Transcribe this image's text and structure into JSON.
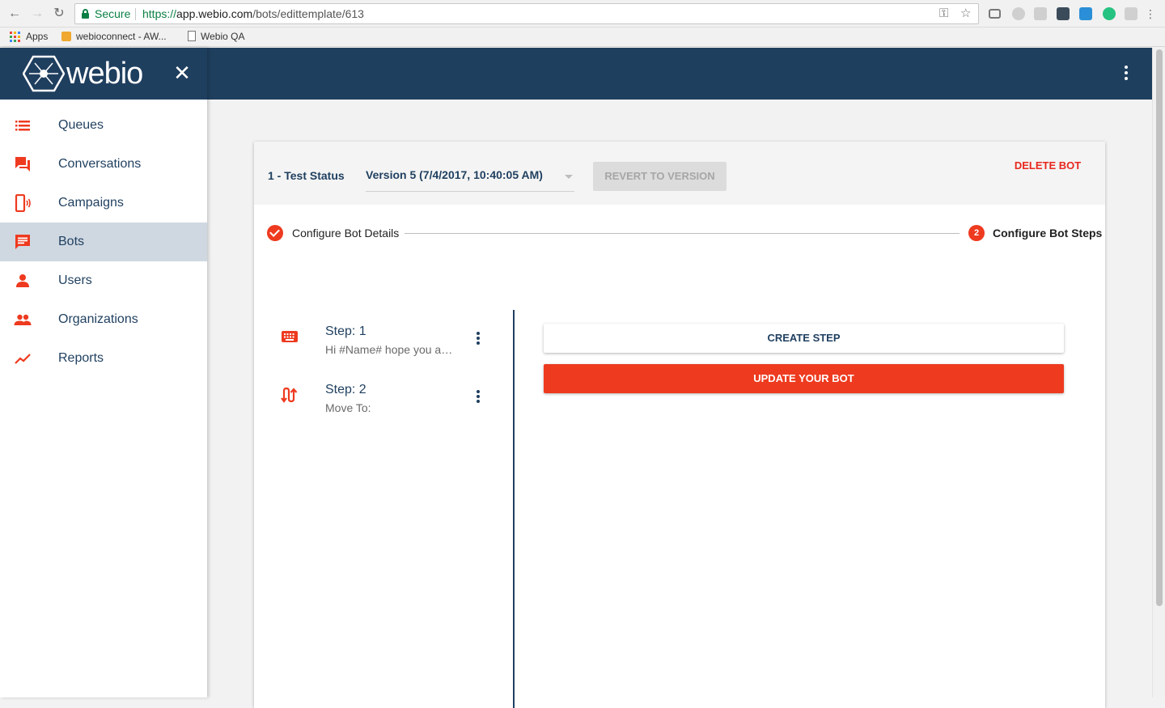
{
  "browser": {
    "secure_label": "Secure",
    "url_scheme": "https://",
    "url_host": "app.webio.com",
    "url_path": "/bots/edittemplate/613",
    "bookmarks": [
      {
        "label": "Apps",
        "icon": "apps-grid-icon"
      },
      {
        "label": "webioconnect - AW...",
        "icon": "box-icon"
      },
      {
        "label": "Webio QA",
        "icon": "page-icon"
      }
    ]
  },
  "brand": {
    "name": "webio",
    "header_color": "#1f3f5f",
    "accent_color": "#ee3a1f",
    "active_nav_color": "#cfd8e1"
  },
  "sidebar": {
    "items": [
      {
        "label": "Queues",
        "icon": "list-icon"
      },
      {
        "label": "Conversations",
        "icon": "chat-icon"
      },
      {
        "label": "Campaigns",
        "icon": "phone-ring-icon"
      },
      {
        "label": "Bots",
        "icon": "message-icon",
        "active": true
      },
      {
        "label": "Users",
        "icon": "person-icon"
      },
      {
        "label": "Organizations",
        "icon": "people-icon"
      },
      {
        "label": "Reports",
        "icon": "trend-icon"
      }
    ]
  },
  "bot": {
    "status_label": "1 - Test Status",
    "version_selected": "Version 5 (7/4/2017, 10:40:05 AM)",
    "revert_label": "REVERT TO VERSION",
    "delete_label": "DELETE BOT"
  },
  "stepper": {
    "step1_label": "Configure Bot Details",
    "step2_number": "2",
    "step2_label": "Configure Bot Steps"
  },
  "steps": [
    {
      "title": "Step: 1",
      "subtitle": "Hi #Name# hope you are well",
      "icon": "keyboard-icon"
    },
    {
      "title": "Step: 2",
      "subtitle": "Move To:",
      "icon": "move-icon"
    }
  ],
  "actions": {
    "create_step": "CREATE STEP",
    "update_bot": "UPDATE YOUR BOT"
  }
}
